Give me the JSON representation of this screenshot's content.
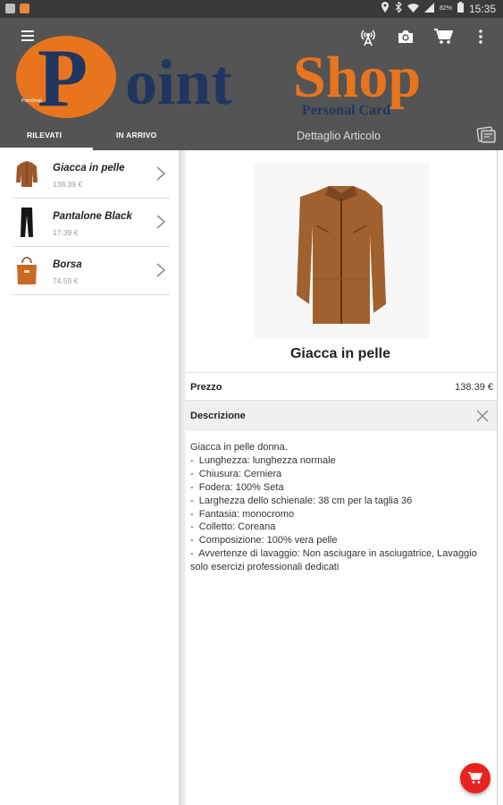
{
  "status_bar": {
    "battery": "82%",
    "time": "15:35"
  },
  "app": {
    "logo_text_main": "PointShop",
    "logo_text_sub": "Personal Card",
    "logo_tiny": "PointShop",
    "tabs": [
      {
        "label": "RILEVATI",
        "active": true
      },
      {
        "label": "IN ARRIVO",
        "active": false
      }
    ],
    "detail_title": "Dettaglio Articolo"
  },
  "list": [
    {
      "name": "Giacca in pelle",
      "price": "138.39 €",
      "icon": "jacket-thumbnail"
    },
    {
      "name": "Pantalone Black",
      "price": "17.39 €",
      "icon": "pants-thumbnail"
    },
    {
      "name": "Borsa",
      "price": "74.59 €",
      "icon": "bag-thumbnail"
    }
  ],
  "detail": {
    "title": "Giacca in pelle",
    "price_label": "Prezzo",
    "price_value": "138.39 €",
    "description_label": "Descrizione",
    "description": "Giacca in pelle donna.\n-  Lunghezza: lunghezza normale\n-  Chiusura: Cerniera\n-  Fodera: 100% Seta\n-  Larghezza dello schienale: 38 cm per la taglia 36\n-  Fantasia: monocromo\n-  Colletto: Coreana\n-  Composizione: 100% vera pelle\n-  Avvertenze di lavaggio: Non asciugare in asciugatrice, Lavaggio solo esercizi professionali dedicati"
  },
  "colors": {
    "appbar": "#545454",
    "logo_orange": "#e8751e",
    "logo_navy": "#1f3760",
    "fab": "#e8221e"
  }
}
